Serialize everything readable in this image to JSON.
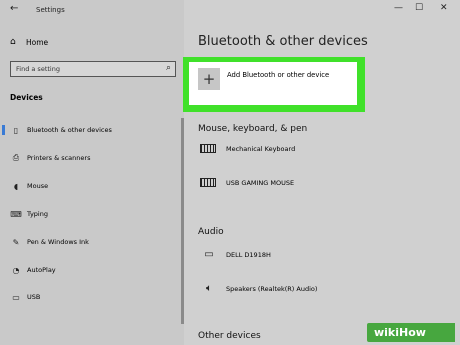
{
  "window": {
    "title": "Settings",
    "controls": [
      "—",
      "☐",
      "✕"
    ]
  },
  "sidebar": {
    "home_label": "Home",
    "search_placeholder": "Find a setting",
    "section_label": "Devices",
    "items": [
      {
        "label": "Bluetooth & other devices",
        "icon": "bluetooth-icon",
        "active": true
      },
      {
        "label": "Printers & scanners",
        "icon": "printer-icon",
        "active": false
      },
      {
        "label": "Mouse",
        "icon": "mouse-icon",
        "active": false
      },
      {
        "label": "Typing",
        "icon": "keyboard-icon",
        "active": false
      },
      {
        "label": "Pen & Windows Ink",
        "icon": "pen-icon",
        "active": false
      },
      {
        "label": "AutoPlay",
        "icon": "autoplay-icon",
        "active": false
      },
      {
        "label": "USB",
        "icon": "usb-icon",
        "active": false
      }
    ]
  },
  "main": {
    "heading": "Bluetooth & other devices",
    "add_device_label": "Add Bluetooth or other device",
    "groups": [
      {
        "title": "Mouse, keyboard, & pen",
        "devices": [
          "Mechanical Keyboard",
          "USB GAMING MOUSE"
        ]
      },
      {
        "title": "Audio",
        "devices": [
          "DELL D1918H",
          "Speakers (Realtek(R) Audio)"
        ]
      },
      {
        "title": "Other devices",
        "devices": []
      }
    ]
  },
  "watermark": "wikiHow",
  "colors": {
    "highlight": "#40e12a",
    "accent": "#3a7bd5"
  }
}
